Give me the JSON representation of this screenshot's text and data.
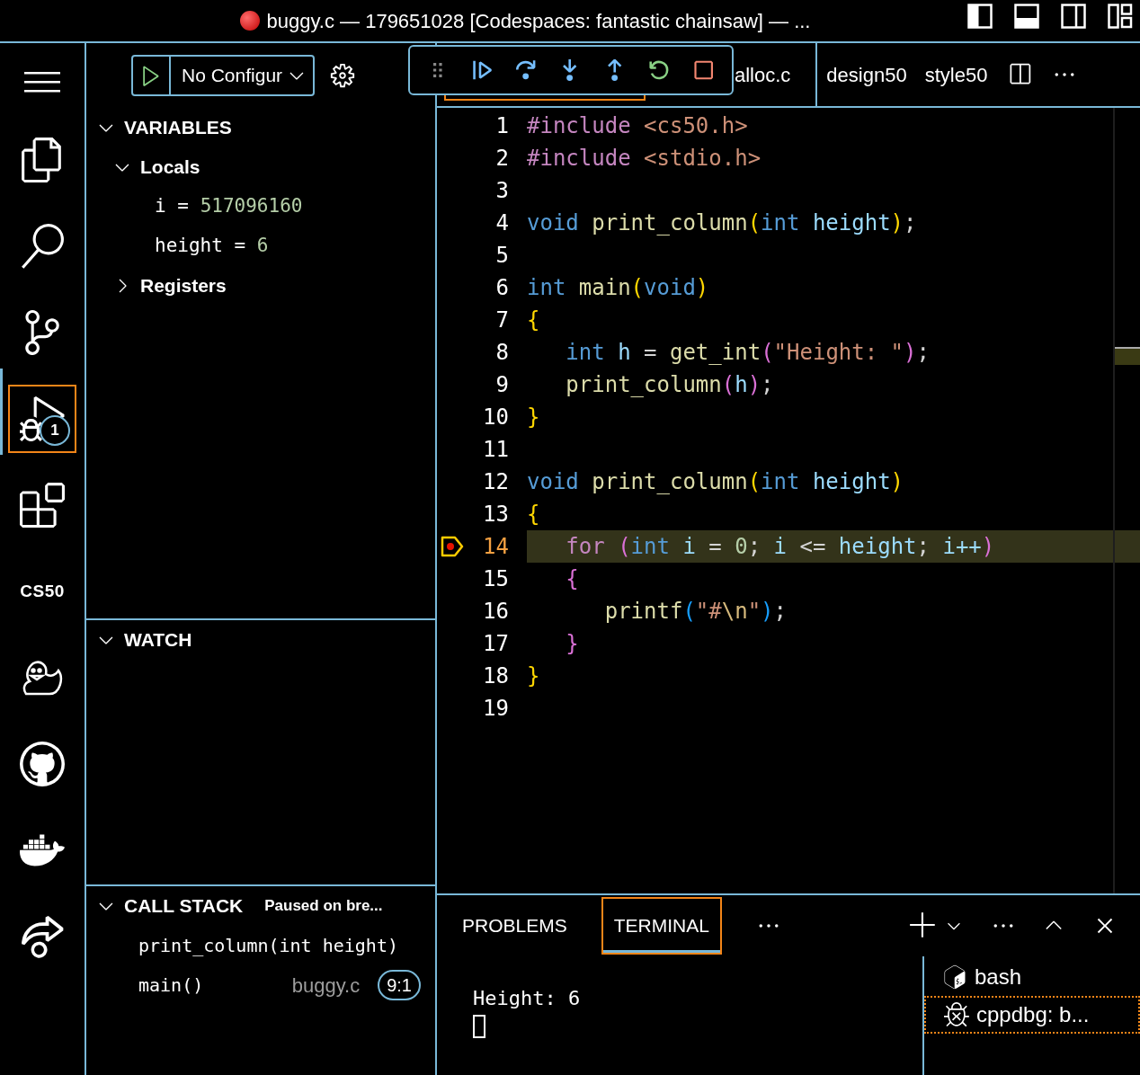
{
  "window": {
    "title": "buggy.c — 179651028 [Codespaces: fantastic chainsaw] — ..."
  },
  "activity_bar": [
    {
      "kind": "icon",
      "selected": false
    },
    {
      "kind": "icon",
      "selected": false
    },
    {
      "kind": "icon",
      "selected": false
    },
    {
      "kind": "icon",
      "selected": true,
      "badge": "1"
    },
    {
      "kind": "icon",
      "selected": false
    },
    {
      "kind": "text",
      "label": "CS50",
      "selected": false
    },
    {
      "kind": "icon",
      "selected": false
    },
    {
      "kind": "icon",
      "selected": false
    },
    {
      "kind": "icon",
      "selected": false
    },
    {
      "kind": "icon",
      "selected": false
    }
  ],
  "run_toolbar": {
    "configuration": "No Configur"
  },
  "variables": {
    "title": "VARIABLES",
    "expanded": true,
    "scopes": [
      {
        "label": "Locals",
        "expanded": true,
        "children": [
          {
            "name": "i",
            "operator": "=",
            "value": "517096160"
          },
          {
            "name": "height",
            "operator": "=",
            "value": "6"
          }
        ]
      },
      {
        "label": "Registers",
        "expanded": false
      }
    ]
  },
  "watch": {
    "title": "WATCH",
    "expanded": true
  },
  "call_stack": {
    "title": "CALL STACK",
    "status": "Paused on bre...",
    "expanded": true,
    "frames": [
      {
        "name": "print_column(int height)"
      },
      {
        "name": "main()",
        "file": "buggy.c",
        "position": "9:1"
      }
    ]
  },
  "editor": {
    "tabs": [
      {
        "selected": true
      },
      {
        "label": "alloc.c",
        "selected": false
      },
      {
        "label": "design50",
        "selected": false
      },
      {
        "label": "style50",
        "selected": false
      }
    ],
    "lines": [
      {
        "number": "1",
        "current": false,
        "breakpoint": false,
        "tokens": [
          {
            "text": "#include ",
            "kind": "preproc"
          },
          {
            "text": "<cs50.h>",
            "kind": "string"
          }
        ]
      },
      {
        "number": "2",
        "current": false,
        "breakpoint": false,
        "tokens": [
          {
            "text": "#include ",
            "kind": "preproc"
          },
          {
            "text": "<stdio.h>",
            "kind": "string"
          }
        ]
      },
      {
        "number": "3",
        "current": false,
        "breakpoint": false
      },
      {
        "number": "4",
        "current": false,
        "breakpoint": false,
        "tokens": [
          {
            "text": "void ",
            "kind": "keyword"
          },
          {
            "text": "print_column",
            "kind": "function"
          },
          {
            "text": "(",
            "kind": "bracket1"
          },
          {
            "text": "int ",
            "kind": "keyword"
          },
          {
            "text": "height",
            "kind": "variable"
          },
          {
            "text": ")",
            "kind": "bracket1"
          },
          {
            "text": ";",
            "kind": "plain"
          }
        ]
      },
      {
        "number": "5",
        "current": false,
        "breakpoint": false
      },
      {
        "number": "6",
        "current": false,
        "breakpoint": false,
        "tokens": [
          {
            "text": "int ",
            "kind": "keyword"
          },
          {
            "text": "main",
            "kind": "function"
          },
          {
            "text": "(",
            "kind": "bracket1"
          },
          {
            "text": "void",
            "kind": "keyword"
          },
          {
            "text": ")",
            "kind": "bracket1"
          }
        ]
      },
      {
        "number": "7",
        "current": false,
        "breakpoint": false,
        "tokens": [
          {
            "text": "{",
            "kind": "bracket1"
          }
        ]
      },
      {
        "number": "8",
        "current": false,
        "breakpoint": false,
        "tokens": [
          {
            "text": "   int ",
            "kind": "keyword"
          },
          {
            "text": "h ",
            "kind": "variable"
          },
          {
            "text": "= ",
            "kind": "plain"
          },
          {
            "text": "get_int",
            "kind": "function"
          },
          {
            "text": "(",
            "kind": "bracket2"
          },
          {
            "text": "\"Height: \"",
            "kind": "string"
          },
          {
            "text": ")",
            "kind": "bracket2"
          },
          {
            "text": ";",
            "kind": "plain"
          }
        ]
      },
      {
        "number": "9",
        "current": false,
        "breakpoint": false,
        "tokens": [
          {
            "text": "   print_column",
            "kind": "function"
          },
          {
            "text": "(",
            "kind": "bracket2"
          },
          {
            "text": "h",
            "kind": "variable"
          },
          {
            "text": ")",
            "kind": "bracket2"
          },
          {
            "text": ";",
            "kind": "plain"
          }
        ]
      },
      {
        "number": "10",
        "current": false,
        "breakpoint": false,
        "tokens": [
          {
            "text": "}",
            "kind": "bracket1"
          }
        ]
      },
      {
        "number": "11",
        "current": false,
        "breakpoint": false
      },
      {
        "number": "12",
        "current": false,
        "breakpoint": false,
        "tokens": [
          {
            "text": "void ",
            "kind": "keyword"
          },
          {
            "text": "print_column",
            "kind": "function"
          },
          {
            "text": "(",
            "kind": "bracket1"
          },
          {
            "text": "int ",
            "kind": "keyword"
          },
          {
            "text": "height",
            "kind": "variable"
          },
          {
            "text": ")",
            "kind": "bracket1"
          }
        ]
      },
      {
        "number": "13",
        "current": false,
        "breakpoint": false,
        "tokens": [
          {
            "text": "{",
            "kind": "bracket1"
          }
        ]
      },
      {
        "number": "14",
        "current": true,
        "breakpoint": true,
        "tokens": [
          {
            "text": "   for ",
            "kind": "control"
          },
          {
            "text": "(",
            "kind": "bracket2"
          },
          {
            "text": "int ",
            "kind": "keyword"
          },
          {
            "text": "i ",
            "kind": "variable"
          },
          {
            "text": "= ",
            "kind": "plain"
          },
          {
            "text": "0",
            "kind": "number"
          },
          {
            "text": "; ",
            "kind": "plain"
          },
          {
            "text": "i ",
            "kind": "variable"
          },
          {
            "text": "<= ",
            "kind": "plain"
          },
          {
            "text": "height",
            "kind": "variable"
          },
          {
            "text": "; ",
            "kind": "plain"
          },
          {
            "text": "i++",
            "kind": "variable"
          },
          {
            "text": ")",
            "kind": "bracket2"
          }
        ]
      },
      {
        "number": "15",
        "current": false,
        "breakpoint": false,
        "tokens": [
          {
            "text": "   {",
            "kind": "bracket2"
          }
        ]
      },
      {
        "number": "16",
        "current": false,
        "breakpoint": false,
        "tokens": [
          {
            "text": "      printf",
            "kind": "function"
          },
          {
            "text": "(",
            "kind": "bracket3"
          },
          {
            "text": "\"#",
            "kind": "string"
          },
          {
            "text": "\\n",
            "kind": "escape"
          },
          {
            "text": "\"",
            "kind": "string"
          },
          {
            "text": ")",
            "kind": "bracket3"
          },
          {
            "text": ";",
            "kind": "plain"
          }
        ]
      },
      {
        "number": "17",
        "current": false,
        "breakpoint": false,
        "tokens": [
          {
            "text": "   }",
            "kind": "bracket2"
          }
        ]
      },
      {
        "number": "18",
        "current": false,
        "breakpoint": false,
        "tokens": [
          {
            "text": "}",
            "kind": "bracket1"
          }
        ]
      },
      {
        "number": "19",
        "current": false,
        "breakpoint": false
      }
    ]
  },
  "panel": {
    "tabs": [
      {
        "label": "PROBLEMS",
        "selected": false
      },
      {
        "label": "TERMINAL",
        "selected": true
      }
    ],
    "output": [
      "Height: 6"
    ],
    "terminals": [
      {
        "label": "bash",
        "kind": "shell",
        "selected": false
      },
      {
        "label": "cppdbg: b...",
        "kind": "debug",
        "selected": true
      }
    ]
  }
}
